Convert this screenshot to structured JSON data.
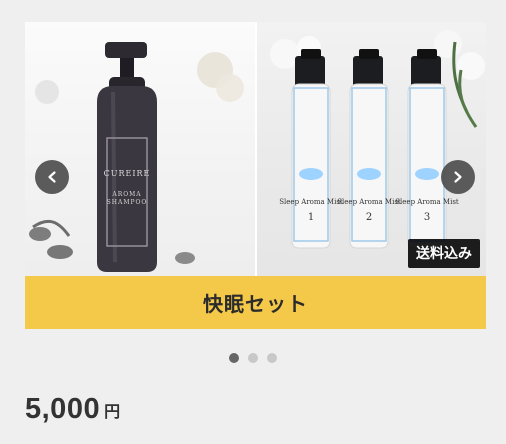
{
  "product": {
    "title": "快眠セット",
    "badge": "送料込み",
    "price": "5,000",
    "currency": "円"
  },
  "image": {
    "left_bottle": {
      "brand": "CUREIRE",
      "label_line_1": "AROMA",
      "label_line_2": "SHAMPOO"
    },
    "sprays": [
      {
        "label": "Sleep Aroma Mist",
        "number": "1"
      },
      {
        "label": "Sleep Aroma Mist",
        "number": "2"
      },
      {
        "label": "Sleep Aroma Mist",
        "number": "3"
      }
    ]
  },
  "carousel": {
    "slide_count": 3,
    "active_index": 0
  },
  "colors": {
    "caption_bar": "#f4c94a",
    "nav_button": "#464646",
    "dot_active": "#666666",
    "dot_inactive": "#c8c8c8",
    "page_background": "#efefef"
  },
  "icons": {
    "prev": "chevron-left-icon",
    "next": "chevron-right-icon"
  }
}
